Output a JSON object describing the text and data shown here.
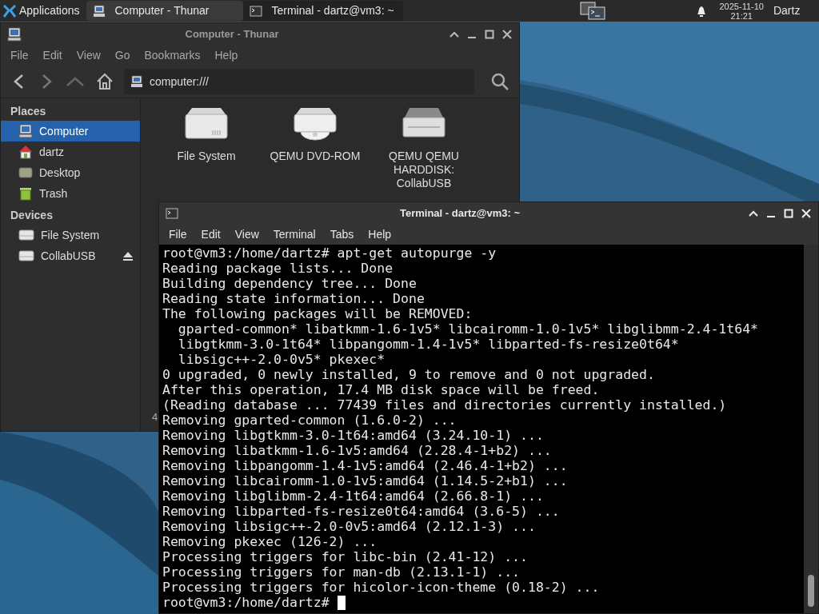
{
  "panel": {
    "apps_label": "Applications",
    "tasks": [
      {
        "title": "Computer - Thunar",
        "kind": "files",
        "selected": true
      },
      {
        "title": "Terminal - dartz@vm3: ~",
        "kind": "terminal",
        "selected": false
      }
    ],
    "clock_date": "2025-11-10",
    "clock_time": "21:21",
    "user": "Dartz"
  },
  "file_manager": {
    "window": {
      "title": "Computer - Thunar"
    },
    "menu": [
      "File",
      "Edit",
      "View",
      "Go",
      "Bookmarks",
      "Help"
    ],
    "location": "computer:///",
    "sidebar": [
      {
        "heading": "Places",
        "items": [
          {
            "label": "Computer",
            "kind": "computer",
            "selected": true
          },
          {
            "label": "dartz",
            "kind": "home",
            "selected": false
          },
          {
            "label": "Desktop",
            "kind": "desktop",
            "selected": false
          },
          {
            "label": "Trash",
            "kind": "trash",
            "selected": false
          }
        ]
      },
      {
        "heading": "Devices",
        "items": [
          {
            "label": "File System",
            "kind": "drive",
            "selected": false
          },
          {
            "label": "CollabUSB",
            "kind": "drive",
            "selected": false,
            "eject": true
          }
        ]
      }
    ],
    "items": [
      {
        "label": "File System",
        "kind": "harddisk"
      },
      {
        "label": "QEMU DVD-ROM",
        "kind": "optical"
      },
      {
        "label": "QEMU QEMU HARDDISK: CollabUSB",
        "kind": "drive"
      }
    ],
    "status_bar": "4"
  },
  "terminal": {
    "window": {
      "title": "Terminal - dartz@vm3: ~"
    },
    "menu": [
      "File",
      "Edit",
      "View",
      "Terminal",
      "Tabs",
      "Help"
    ],
    "lines": [
      "root@vm3:/home/dartz# apt-get autopurge -y",
      "Reading package lists... Done",
      "Building dependency tree... Done",
      "Reading state information... Done",
      "The following packages will be REMOVED:",
      "  gparted-common* libatkmm-1.6-1v5* libcairomm-1.0-1v5* libglibmm-2.4-1t64*",
      "  libgtkmm-3.0-1t64* libpangomm-1.4-1v5* libparted-fs-resize0t64*",
      "  libsigc++-2.0-0v5* pkexec*",
      "0 upgraded, 0 newly installed, 9 to remove and 0 not upgraded.",
      "After this operation, 17.4 MB disk space will be freed.",
      "(Reading database ... 77439 files and directories currently installed.)",
      "Removing gparted-common (1.6.0-2) ...",
      "Removing libgtkmm-3.0-1t64:amd64 (3.24.10-1) ...",
      "Removing libatkmm-1.6-1v5:amd64 (2.28.4-1+b2) ...",
      "Removing libpangomm-1.4-1v5:amd64 (2.46.4-1+b2) ...",
      "Removing libcairomm-1.0-1v5:amd64 (1.14.5-2+b1) ...",
      "Removing libglibmm-2.4-1t64:amd64 (2.66.8-1) ...",
      "Removing libparted-fs-resize0t64:amd64 (3.6-5) ...",
      "Removing libsigc++-2.0-0v5:amd64 (2.12.1-3) ...",
      "Removing pkexec (126-2) ...",
      "Processing triggers for libc-bin (2.41-12) ...",
      "Processing triggers for man-db (2.13.1-1) ...",
      "Processing triggers for hicolor-icon-theme (0.18-2) ...",
      "root@vm3:/home/dartz# "
    ]
  }
}
